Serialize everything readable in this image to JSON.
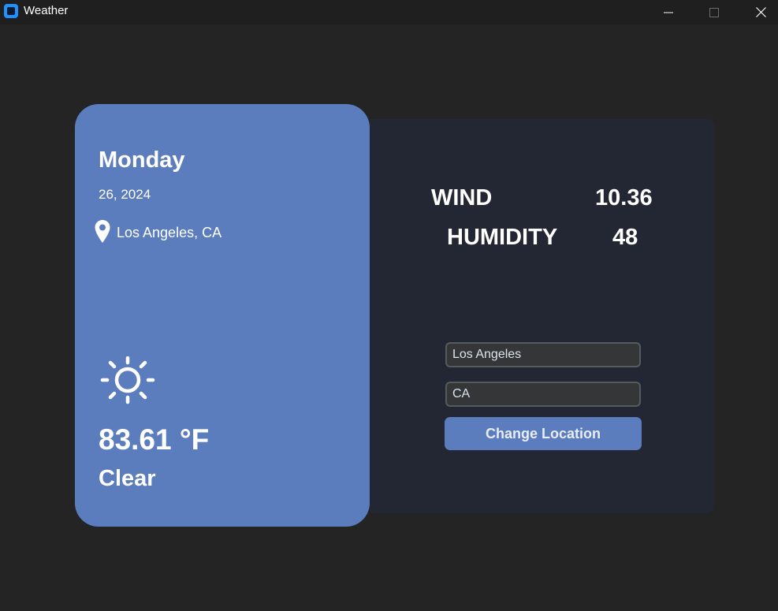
{
  "window": {
    "title": "Weather",
    "icons": {
      "app": "app-icon",
      "minimize": "minimize-icon",
      "maximize": "maximize-icon",
      "close": "close-icon"
    }
  },
  "weather_card": {
    "day": "Monday",
    "date": "26, 2024",
    "location": "Los Angeles, CA",
    "location_icon": "map-pin-icon",
    "condition_icon": "sun-icon",
    "temperature": "83.61 °F",
    "condition": "Clear",
    "background_color": "#5c7dbd"
  },
  "details": {
    "wind_label": "WIND",
    "wind_value": "10.36",
    "humidity_label": "HUMIDITY",
    "humidity_value": "48"
  },
  "location_form": {
    "city_value": "Los Angeles",
    "state_value": "CA",
    "button_label": "Change Location",
    "accent_color": "#5c7dbd"
  }
}
